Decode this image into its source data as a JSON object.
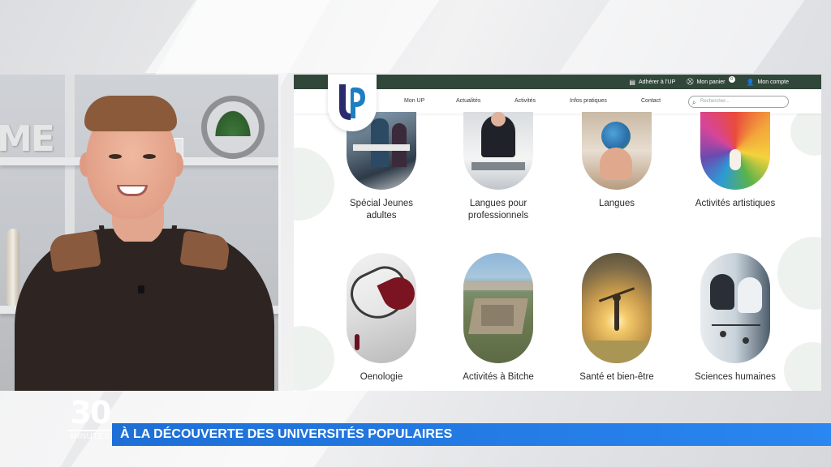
{
  "website": {
    "topbar": {
      "join": "Adhérer à l'UP",
      "cart": "Mon panier",
      "cart_badge": "0",
      "account": "Mon compte"
    },
    "nav": {
      "items": [
        "Mon UP",
        "Actualités",
        "Activités",
        "Infos pratiques",
        "Contact"
      ]
    },
    "search": {
      "placeholder": "Rechercher..."
    },
    "logo": {
      "text": "UP"
    },
    "categories": [
      {
        "label_lines": [
          "Spécial Jeunes",
          "adultes"
        ],
        "image": "young-adults-meeting-photo"
      },
      {
        "label_lines": [
          "Langues pour",
          "professionnels"
        ],
        "image": "businessman-desk-photo"
      },
      {
        "label_lines": [
          "Langues"
        ],
        "image": "hand-holding-globe-photo"
      },
      {
        "label_lines": [
          "Activités artistiques"
        ],
        "image": "colorful-painted-face-art"
      },
      {
        "label_lines": [
          "Oenologie"
        ],
        "image": "wine-glass-photo"
      },
      {
        "label_lines": [
          "Activités à Bitche"
        ],
        "image": "bitche-citadel-aerial-photo"
      },
      {
        "label_lines": [
          "Santé et bien-être"
        ],
        "image": "person-sunset-field-photo"
      },
      {
        "label_lines": [
          "Sciences humaines"
        ],
        "image": "human-head-silhouettes"
      }
    ]
  },
  "broadcast": {
    "show_logo_number": "30",
    "show_logo_word": "MINUTES",
    "headline": "À LA DÉCOUVERTE DES UNIVERSITÉS POPULAIRES",
    "headline_color": "#1d6fd6",
    "backdrop_letters": "ME"
  },
  "colors": {
    "site_header_green": "#31473a",
    "logo_blue": "#1d7fc1",
    "logo_navy": "#2a2a6e"
  }
}
